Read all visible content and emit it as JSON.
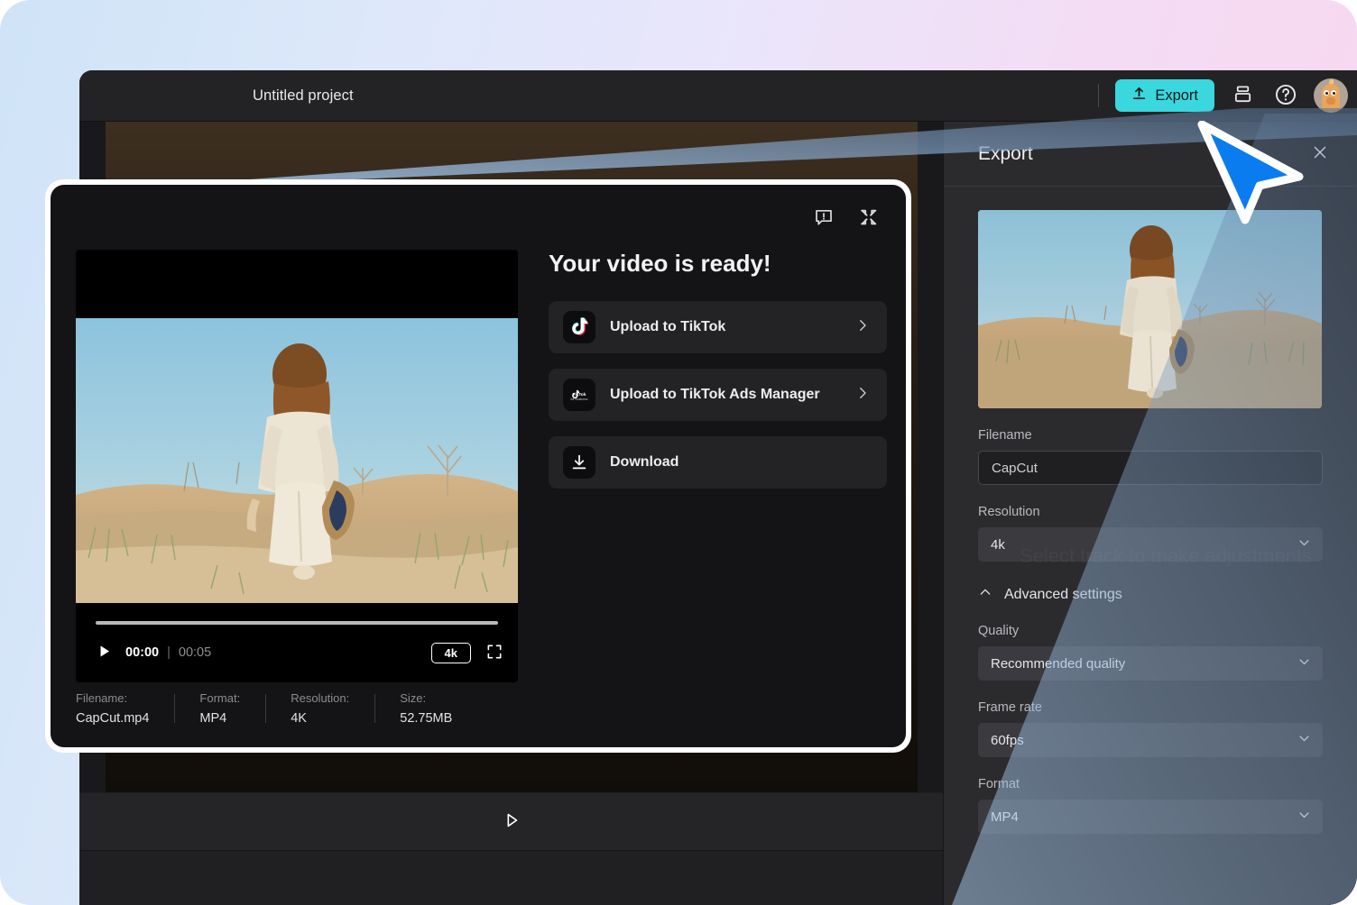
{
  "topbar": {
    "project_title": "Untitled project",
    "export_label": "Export",
    "export_icon": "upload-icon",
    "layers_icon": "layers-icon",
    "help_icon": "help-circle-icon",
    "avatar_icon": "user-avatar"
  },
  "export_panel": {
    "title": "Export",
    "close_icon": "close-icon",
    "thumbnail_alt": "video-thumbnail",
    "fields": [
      {
        "label": "Filename",
        "value": "CapCut",
        "type": "input"
      },
      {
        "label": "Resolution",
        "value": "4k",
        "type": "select"
      }
    ],
    "advanced": {
      "label": "Advanced settings",
      "chevron_icon": "chevron-up-icon",
      "expanded": true,
      "fields": [
        {
          "label": "Quality",
          "value": "Recommended quality",
          "type": "select"
        },
        {
          "label": "Frame rate",
          "value": "60fps",
          "type": "select"
        },
        {
          "label": "Format",
          "value": "MP4",
          "type": "select"
        }
      ]
    }
  },
  "editor": {
    "ghost_hint": "Select track to make adjustments",
    "play_icon": "play-outline-icon"
  },
  "modal": {
    "report_icon": "feedback-icon",
    "minimize_icon": "collapse-icon",
    "heading": "Your video is ready!",
    "actions": [
      {
        "label": "Upload to TikTok",
        "icon": "tiktok-icon",
        "chevron": "chevron-right-icon"
      },
      {
        "label": "Upload to TikTok Ads Manager",
        "icon": "tiktok-business-icon",
        "chevron": "chevron-right-icon"
      },
      {
        "label": "Download",
        "icon": "download-icon",
        "chevron": ""
      }
    ],
    "player": {
      "play_icon": "play-icon",
      "current_time": "00:00",
      "separator": "|",
      "duration": "00:05",
      "quality_badge": "4k",
      "fullscreen_icon": "fullscreen-icon",
      "progress_percent": 0
    },
    "meta": [
      {
        "key": "Filename:",
        "value": "CapCut.mp4"
      },
      {
        "key": "Format:",
        "value": "MP4"
      },
      {
        "key": "Resolution:",
        "value": "4K"
      },
      {
        "key": "Size:",
        "value": "52.75MB"
      }
    ]
  },
  "colors": {
    "accent": "#3ad7de",
    "cursor": "#0a7cf0",
    "panel_bg": "#2b2b2e",
    "modal_bg": "#141416",
    "topbar_bg": "#232325"
  }
}
